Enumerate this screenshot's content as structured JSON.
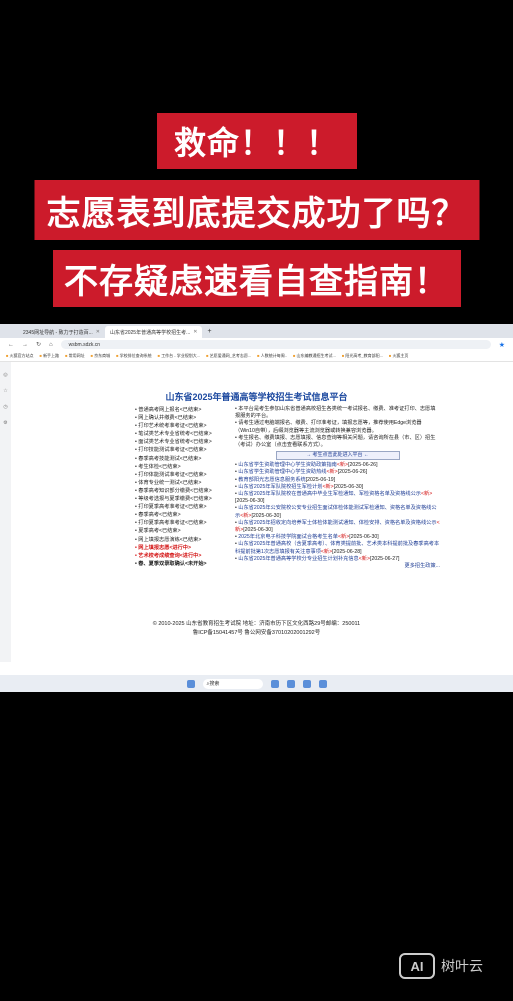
{
  "banners": {
    "line1": "救命！！！",
    "line2": "志愿表到底提交成功了吗？",
    "line3": "不存疑虑速看自查指南！"
  },
  "browser": {
    "tabs": [
      {
        "label": "2345网址导航 - 致力于打造百..."
      },
      {
        "label": "山东省2025年普通高等学校招生考..."
      }
    ],
    "new_tab": "+",
    "url": "wsbm.sdzk.cn",
    "bookmarks": [
      "火狐官方站点",
      "新手上路",
      "常用网址",
      "京东商城",
      "学校排位查询系统",
      "工作台 - 学业规划大...",
      "艺愿爱通网_艺考志愿...",
      "人数统计每周..",
      "山东编教通招生考试...",
      "阳光高考_教育部阳...",
      "火狐主页"
    ]
  },
  "site": {
    "title": "山东省2025年普通高等学校招生考试信息平台",
    "left_menu": [
      {
        "text": "普通高考网上报名<已结束>",
        "style": "normal"
      },
      {
        "text": "网上确认并缴费<已结束>",
        "style": "normal"
      },
      {
        "text": "打印艺术统考准考证<已结束>",
        "style": "normal"
      },
      {
        "text": "笔试类艺术专业省统考<已结束>",
        "style": "normal"
      },
      {
        "text": "面试类艺术专业省统考<已结束>",
        "style": "normal"
      },
      {
        "text": "打印技能测试准考证<已结束>",
        "style": "normal"
      },
      {
        "text": "春季高考技能测试<已结束>",
        "style": "normal"
      },
      {
        "text": "考生体检<已结束>",
        "style": "normal"
      },
      {
        "text": "打印体能测试准考证<已结束>",
        "style": "normal"
      },
      {
        "text": "体育专业统一测试<已结束>",
        "style": "normal"
      },
      {
        "text": "春季高考知识部分缴费<已结束>",
        "style": "normal"
      },
      {
        "text": "等级考选报与夏季缴费<已结束>",
        "style": "normal"
      },
      {
        "text": "打印夏季高考准考证<已结束>",
        "style": "normal"
      },
      {
        "text": "春季高考<已结束>",
        "style": "normal"
      },
      {
        "text": "打印夏季高考准考证<已结束>",
        "style": "normal"
      },
      {
        "text": "夏季高考<已结束>",
        "style": "normal"
      },
      {
        "text": "网上填报志愿演练<已结束>",
        "style": "normal"
      },
      {
        "text": "网上填报志愿<进行中>",
        "style": "red"
      },
      {
        "text": "艺术校考成绩查询<进行中>",
        "style": "red"
      },
      {
        "text": "春、夏季双录取确认<未开始>",
        "style": "black"
      }
    ],
    "notices": [
      "本平台是考生参加山东省普通高校招生各类统一考试报名、缴费、准考证打印、志愿填报服务的平台。",
      "请考生通过电脑端报名、缴费、打印准考证，填报志愿等，推荐使用Edge浏览器（Win10自带），后缀浏览器等主流浏览器或转换兼容浏览器。",
      "考生报名、缴费填报、志愿填报、信息查询等相关问题，请咨询所在县（市、区）招生（考试）办公室（点击查看联系方式）。"
    ],
    "enter_button": "→ 考生点击此处进入平台 ←",
    "news": [
      {
        "text": "山东省学生资助管理中心学生资助政策指南",
        "tag": "<新>",
        "date": "[2025-06-26]"
      },
      {
        "text": "山东省学生资助管理中心学生资助热线",
        "tag": "<新>",
        "date": "[2025-06-26]"
      },
      {
        "text": "教育部阳光志愿信息服务系统",
        "tag": "",
        "date": "[2025-06-19]"
      },
      {
        "text": "山东省2025年军队院校招生军检计划",
        "tag": "<新>",
        "date": "[2025-06-30]"
      },
      {
        "text": "山东省2025年军队院校在普通高中毕业生军检通知、军检资格名单及资格线公示",
        "tag": "<新>",
        "date": "[2025-06-30]"
      },
      {
        "text": "山东省2025年公安院校公安专业招生面试体检体能测试军检通知、资格名单及资格线公示",
        "tag": "<新>",
        "date": "[2025-06-30]"
      },
      {
        "text": "山东省2025年招收定向培养军士体检体能测试通知、体检安排、资格名单及资格线公示",
        "tag": "<新>",
        "date": "[2025-06-30]"
      },
      {
        "text": "2025年北京电子科技学院面试合格考生名单",
        "tag": "<新>",
        "date": "[2025-06-30]"
      },
      {
        "text": "山东省2025年普通高校（含夏季高考）、体育类提前批、艺术类本科提前批及春季高考本科提前批第1次志愿填报有关注意事项",
        "tag": "<新>",
        "date": "[2025-06-28]"
      },
      {
        "text": "山东省2025年普通高等学校分专业招生计划补充信息",
        "tag": "<新>",
        "date": "[2025-06-27]"
      }
    ],
    "more": "更多招生政策...",
    "footer_line1": "© 2010-2025 山东省教育招生考试院 地址：济南市历下区文化西路29号邮编：250011",
    "footer_line2": "鲁ICP备15041457号 鲁公网安备37010202001292号"
  },
  "taskbar": {
    "search_placeholder": "搜索"
  },
  "watermark": {
    "logo": "AI",
    "text": "树叶云"
  }
}
